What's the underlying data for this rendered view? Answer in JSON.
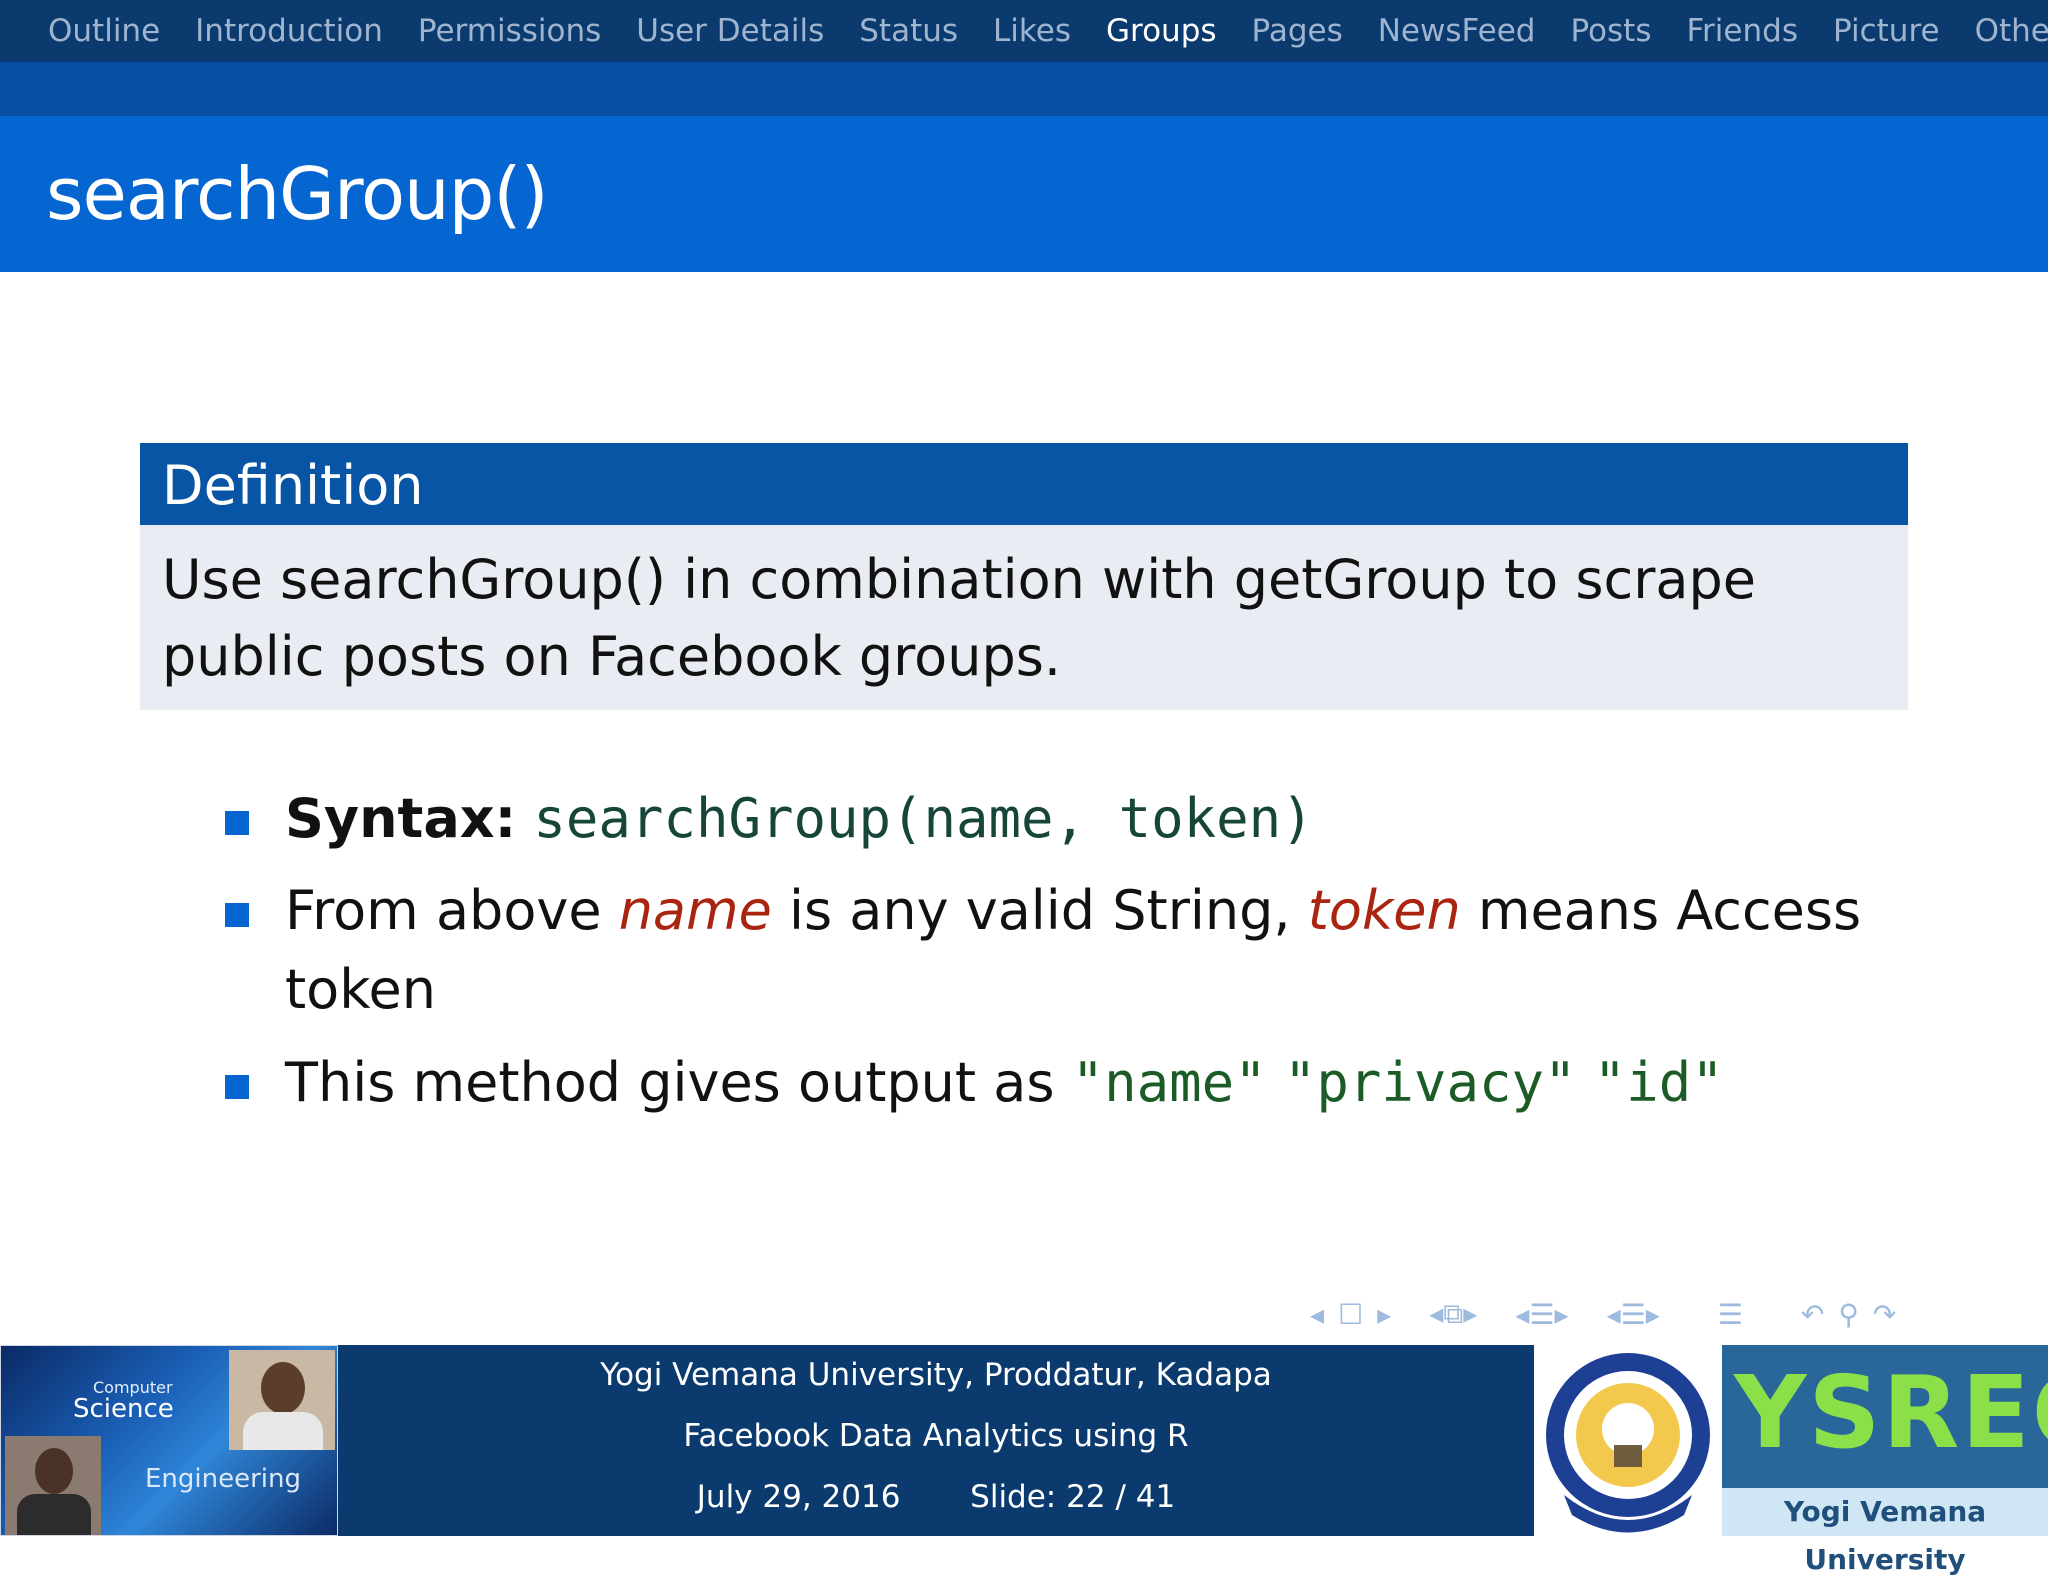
{
  "nav": {
    "items": [
      "Outline",
      "Introduction",
      "Permissions",
      "User Details",
      "Status",
      "Likes",
      "Groups",
      "Pages",
      "NewsFeed",
      "Posts",
      "Friends",
      "Picture",
      "Others"
    ],
    "active": "Groups"
  },
  "slide": {
    "title": "searchGroup()",
    "definition": {
      "heading": "Definition",
      "body": "Use searchGroup() in combination with getGroup to scrape public posts on Facebook groups."
    },
    "bullets": {
      "syntax_label": "Syntax:",
      "syntax_code": "searchGroup(name, token)",
      "b2_pre": "From above ",
      "b2_em1": "name",
      "b2_mid": " is any valid String, ",
      "b2_em2": "token",
      "b2_post": " means Access token",
      "b3_pre": "This method gives output as ",
      "b3_codes": [
        "\"name\"",
        "\"privacy\"",
        "\"id\""
      ]
    }
  },
  "footer": {
    "line1": "Yogi Vemana University, Proddatur, Kadapa",
    "line2": "Facebook Data Analytics using R",
    "date": "July 29, 2016",
    "slide_label": "Slide:",
    "slide_current": "22",
    "slide_total": "41",
    "photo_text_top": "Computer",
    "photo_text_mid": "Science",
    "photo_text_bottom": "Engineering",
    "logo_text": "YSREC",
    "logo_subtext": "Yogi Vemana University"
  },
  "colors": {
    "nav_bg": "#0b3b6e",
    "title_bar": "#0565d1",
    "definition_head": "#0755a4",
    "definition_body": "#e9ecf3",
    "code_green": "#1b5c26",
    "emphasis_red": "#a9250f"
  },
  "icons": [
    "nav-frame-prev-icon",
    "nav-frame-icon",
    "nav-frame-next-icon",
    "nav-subsection-icon",
    "nav-section-icon",
    "nav-doc-icon",
    "nav-undo-icon",
    "nav-search-icon",
    "nav-redo-icon"
  ]
}
